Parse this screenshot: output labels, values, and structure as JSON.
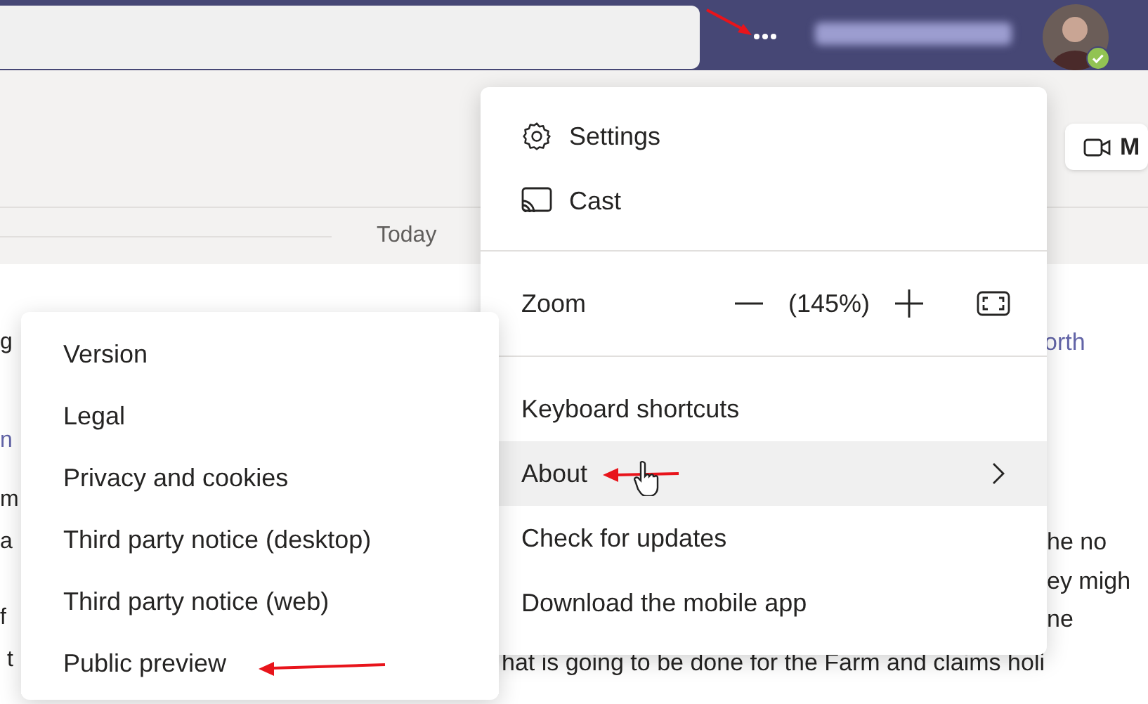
{
  "header": {
    "date_divider": "Today",
    "meet_button": "M"
  },
  "background_text": [
    {
      "kind": "text",
      "text": "g"
    },
    {
      "kind": "link",
      "text": "orth"
    },
    {
      "kind": "link",
      "text": "n"
    },
    {
      "kind": "text",
      "text": "m"
    },
    {
      "kind": "text",
      "text": "a"
    },
    {
      "kind": "text",
      "text": "f"
    },
    {
      "kind": "text",
      "text": "t"
    },
    {
      "kind": "text",
      "text": "he no"
    },
    {
      "kind": "text",
      "text": "ey migh"
    },
    {
      "kind": "text",
      "text": "ne"
    },
    {
      "kind": "text",
      "text": "hat is going to be done for the Farm and claims holi"
    }
  ],
  "menu": {
    "groups": [
      [
        {
          "kind": "item",
          "label": "Settings",
          "selected": false,
          "has_submenu": false
        },
        {
          "kind": "item",
          "label": "Cast",
          "selected": false,
          "has_submenu": false
        }
      ],
      [
        {
          "kind": "zoom",
          "label": "Zoom",
          "value": "(145%)"
        }
      ],
      [
        {
          "kind": "item",
          "label": "Keyboard shortcuts",
          "selected": false,
          "has_submenu": false
        },
        {
          "kind": "item",
          "label": "About",
          "selected": true,
          "has_submenu": true
        },
        {
          "kind": "item",
          "label": "Check for updates",
          "selected": false,
          "has_submenu": false
        },
        {
          "kind": "item",
          "label": "Download the mobile app",
          "selected": false,
          "has_submenu": false
        }
      ]
    ]
  },
  "submenu": {
    "items": [
      {
        "label": "Version",
        "selected": false
      },
      {
        "label": "Legal",
        "selected": false
      },
      {
        "label": "Privacy and cookies",
        "selected": false
      },
      {
        "label": "Third party notice (desktop)",
        "selected": false
      },
      {
        "label": "Third party notice (web)",
        "selected": false
      },
      {
        "label": "Public preview",
        "selected": false
      }
    ]
  }
}
